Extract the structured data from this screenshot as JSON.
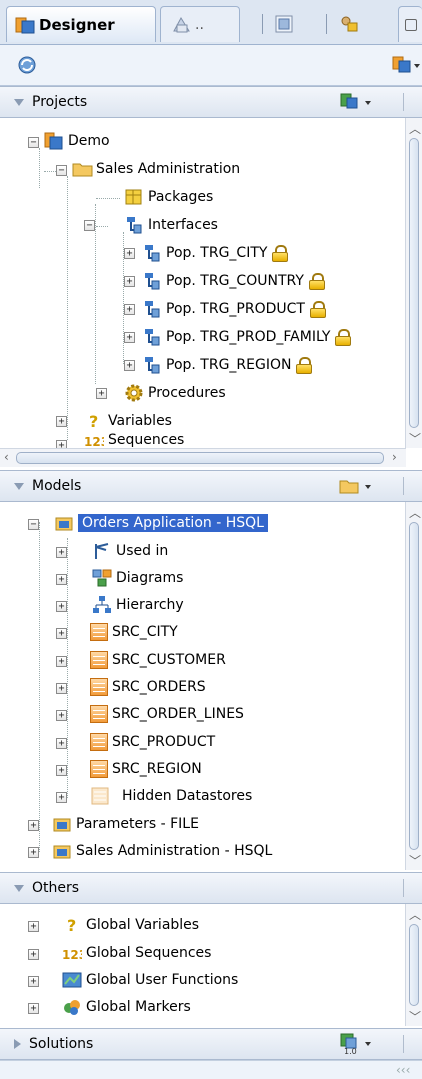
{
  "tabs": [
    {
      "label": "Designer",
      "icon": "designer-icon",
      "active": true
    },
    {
      "label": "..",
      "icon": "operator-icon",
      "active": false
    },
    {
      "label": "",
      "icon": "topology-icon",
      "active": false
    },
    {
      "label": "",
      "icon": "security-icon",
      "active": false
    }
  ],
  "toolbar": {
    "refresh_icon": "refresh-icon",
    "menu_icon": "designer-menu-icon"
  },
  "projects": {
    "header": "Projects",
    "tree": {
      "demo": "Demo",
      "sales_admin": "Sales Administration",
      "packages": "Packages",
      "interfaces": "Interfaces",
      "interface_items": [
        "Pop. TRG_CITY",
        "Pop. TRG_COUNTRY",
        "Pop. TRG_PRODUCT",
        "Pop. TRG_PROD_FAMILY",
        "Pop. TRG_REGION"
      ],
      "procedures": "Procedures",
      "variables": "Variables",
      "sequences": "Sequences"
    }
  },
  "models": {
    "header": "Models",
    "tree": {
      "orders_app": "Orders Application - HSQL",
      "used_in": "Used in",
      "diagrams": "Diagrams",
      "hierarchy": "Hierarchy",
      "datastores": [
        "SRC_CITY",
        "SRC_CUSTOMER",
        "SRC_ORDERS",
        "SRC_ORDER_LINES",
        "SRC_PRODUCT",
        "SRC_REGION"
      ],
      "hidden": "Hidden Datastores",
      "parameters": "Parameters - FILE",
      "sales_admin_hsql": "Sales Administration - HSQL"
    }
  },
  "others": {
    "header": "Others",
    "items": [
      "Global Variables",
      "Global Sequences",
      "Global User Functions",
      "Global Markers"
    ]
  },
  "solutions": {
    "header": "Solutions",
    "badge": "1.0"
  }
}
